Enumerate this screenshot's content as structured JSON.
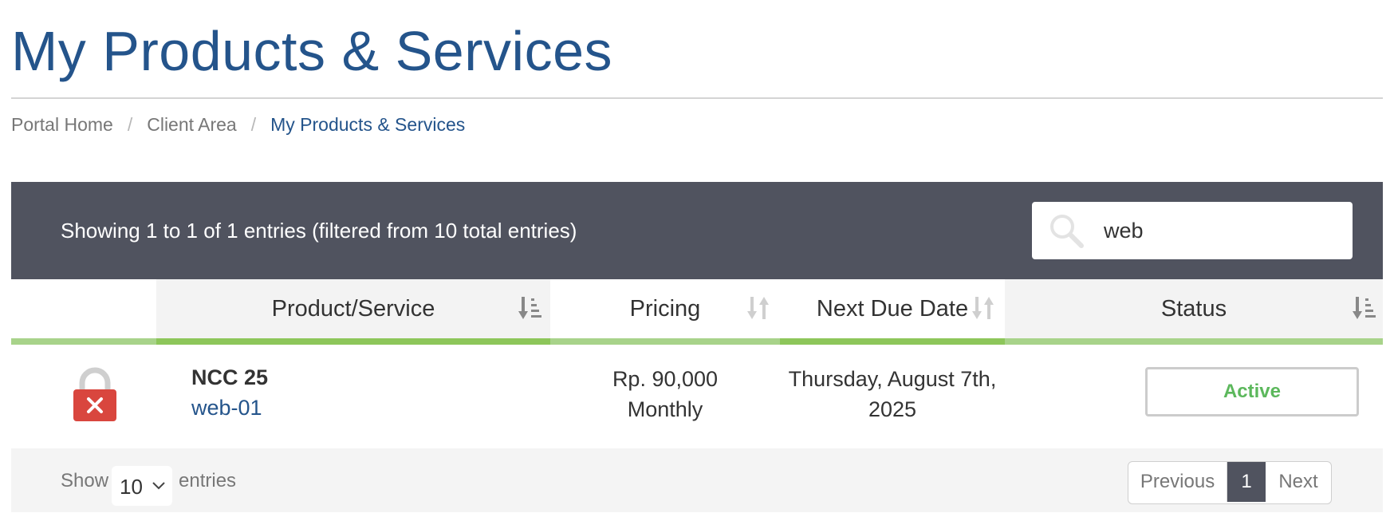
{
  "page": {
    "title": "My Products & Services"
  },
  "breadcrumb": {
    "items": [
      {
        "label": "Portal Home"
      },
      {
        "label": "Client Area"
      },
      {
        "label": "My Products & Services"
      }
    ],
    "separator": "/"
  },
  "table": {
    "info": "Showing 1 to 1 of 1 entries (filtered from 10 total entries)",
    "search": {
      "value": "web",
      "icon": "search-icon"
    },
    "columns": [
      {
        "label": "",
        "sort": "none"
      },
      {
        "label": "Product/Service",
        "sort": "ascending"
      },
      {
        "label": "Pricing",
        "sort": "unsorted"
      },
      {
        "label": "Next Due Date",
        "sort": "unsorted"
      },
      {
        "label": "Status",
        "sort": "ascending"
      }
    ],
    "rows": [
      {
        "icon": "locked-error-icon",
        "product": "NCC 25",
        "domain": "web-01",
        "price": "Rp. 90,000",
        "cycle": "Monthly",
        "due_line1": "Thursday, August 7th,",
        "due_line2": "2025",
        "status": "Active"
      }
    ]
  },
  "footer": {
    "show_label": "Show",
    "page_length": "10",
    "entries_label": "entries",
    "pagination": {
      "previous": "Previous",
      "current": "1",
      "next": "Next"
    }
  },
  "colors": {
    "brand": "#24548b",
    "toolbar": "#50535f",
    "accent_green": "#8dc65a",
    "status_active": "#5cb85c",
    "error_red": "#d9463e"
  }
}
